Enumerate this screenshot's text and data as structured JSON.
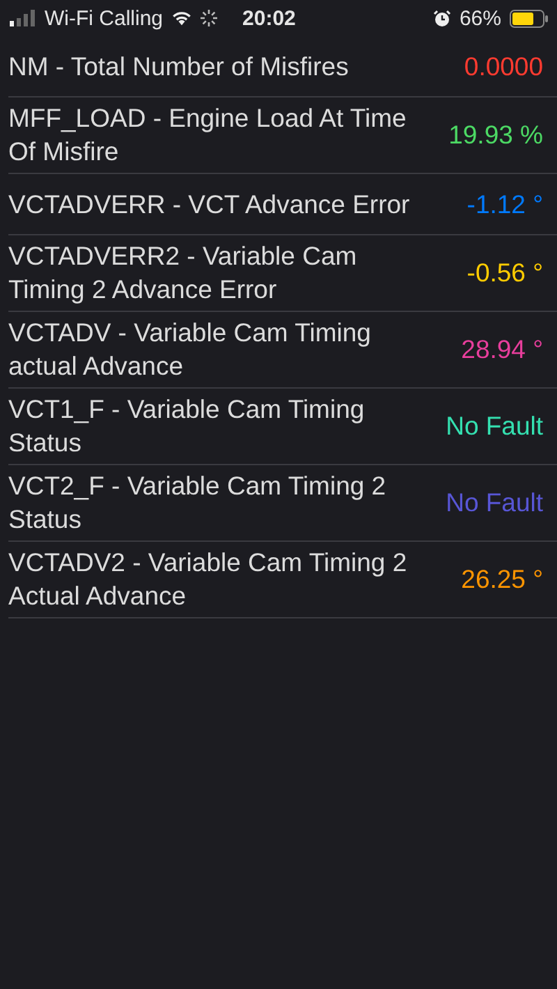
{
  "status_bar": {
    "carrier": "Wi-Fi Calling",
    "time": "20:02",
    "battery": "66%"
  },
  "rows": [
    {
      "label": "NM - Total Number of Misfires",
      "value": "0.0000",
      "color": "#ff3b30"
    },
    {
      "label": "MFF_LOAD - Engine Load At Time Of Misfire",
      "value": "19.93 %",
      "color": "#4cd964"
    },
    {
      "label": "VCTADVERR - VCT Advance Error",
      "value": "-1.12 °",
      "color": "#007aff"
    },
    {
      "label": "VCTADVERR2 - Variable Cam Timing 2 Advance Error",
      "value": "-0.56 °",
      "color": "#ffcc00"
    },
    {
      "label": "VCTADV - Variable Cam Timing actual Advance",
      "value": "28.94 °",
      "color": "#e83e9c"
    },
    {
      "label": "VCT1_F - Variable Cam Timing Status",
      "value": "No Fault",
      "color": "#34e0b0"
    },
    {
      "label": "VCT2_F - Variable Cam Timing 2 Status",
      "value": "No Fault",
      "color": "#5856d6"
    },
    {
      "label": "VCTADV2 - Variable Cam Timing 2 Actual Advance",
      "value": "26.25 °",
      "color": "#ff9500"
    }
  ]
}
